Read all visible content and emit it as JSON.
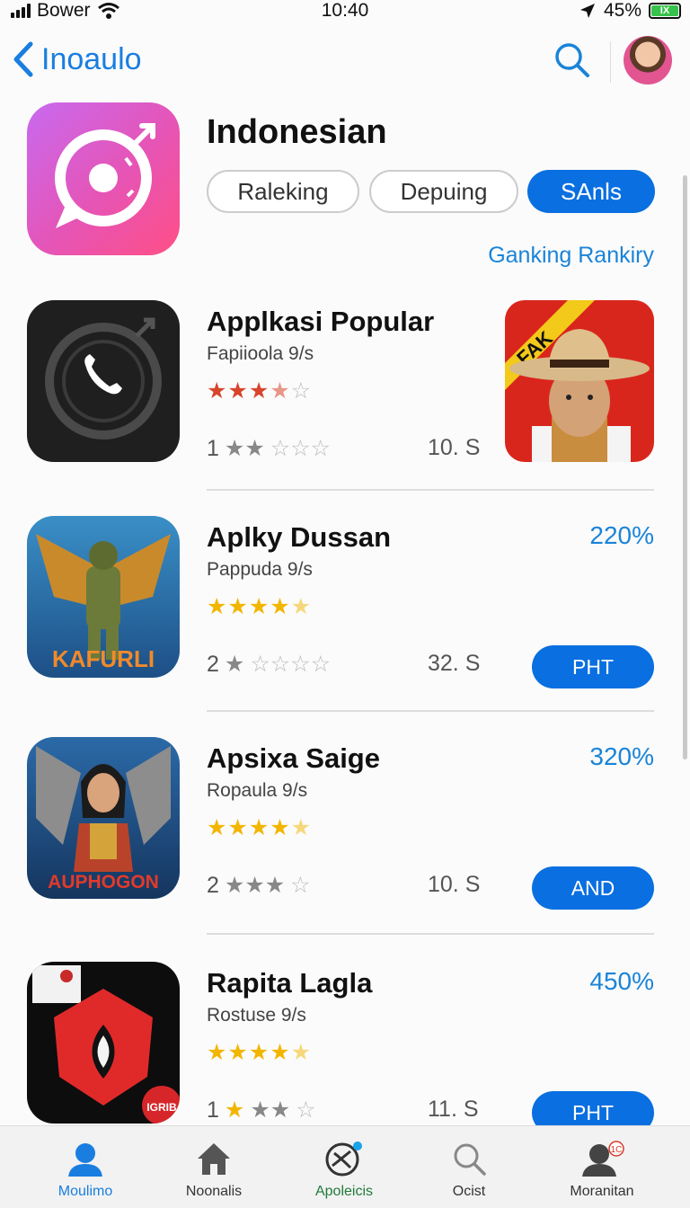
{
  "status_bar": {
    "carrier": "Bower",
    "time": "10:40",
    "battery": "45%"
  },
  "nav": {
    "back_label": "Inoaulo"
  },
  "header": {
    "title": "Indonesian",
    "chips": [
      "Raleking",
      "Depuing",
      "SAnls"
    ],
    "active_chip": "SAnls",
    "ranking_link": "Ganking Rankiry"
  },
  "apps": [
    {
      "name": "Applkasi Popular",
      "subtitle": "Fapiioola 9/s",
      "rating_top": 3.5,
      "rating_count": "1",
      "rating_bottom": 2,
      "size": "10. S",
      "icon_text": "",
      "thumb_text": "FAK"
    },
    {
      "name": "Aplky Dussan",
      "subtitle": "Pappuda 9/s",
      "rating_top": 4.5,
      "rating_count": "2",
      "rating_bottom": 1,
      "size": "32. S",
      "percent": "220%",
      "button": "PHT",
      "icon_text": "KAFURLI"
    },
    {
      "name": "Apsixa Saige",
      "subtitle": "Ropaula 9/s",
      "rating_top": 4.5,
      "rating_count": "2",
      "rating_bottom": 3,
      "size": "10. S",
      "percent": "320%",
      "button": "AND",
      "icon_text": "AUPHOGON"
    },
    {
      "name": "Rapita Lagla",
      "subtitle": "Rostuse 9/s",
      "rating_top": 4.5,
      "rating_count": "1",
      "rating_bottom": 2,
      "size": "11. S",
      "percent": "450%",
      "button": "PHT",
      "icon_text": "IGRIB"
    }
  ],
  "tabs": [
    "Moulimo",
    "Noonalis",
    "Apoleicis",
    "Ocist",
    "Moranitan"
  ],
  "tab_badge": "1C",
  "colors": {
    "accent": "#0a6fe0",
    "link": "#1a84d8",
    "star_gold": "#f2b600",
    "star_red": "#d8442c"
  },
  "icons": [
    "back-chevron-icon",
    "search-icon",
    "person-icon",
    "home-icon",
    "apps-icon",
    "search-icon",
    "profile-icon"
  ]
}
